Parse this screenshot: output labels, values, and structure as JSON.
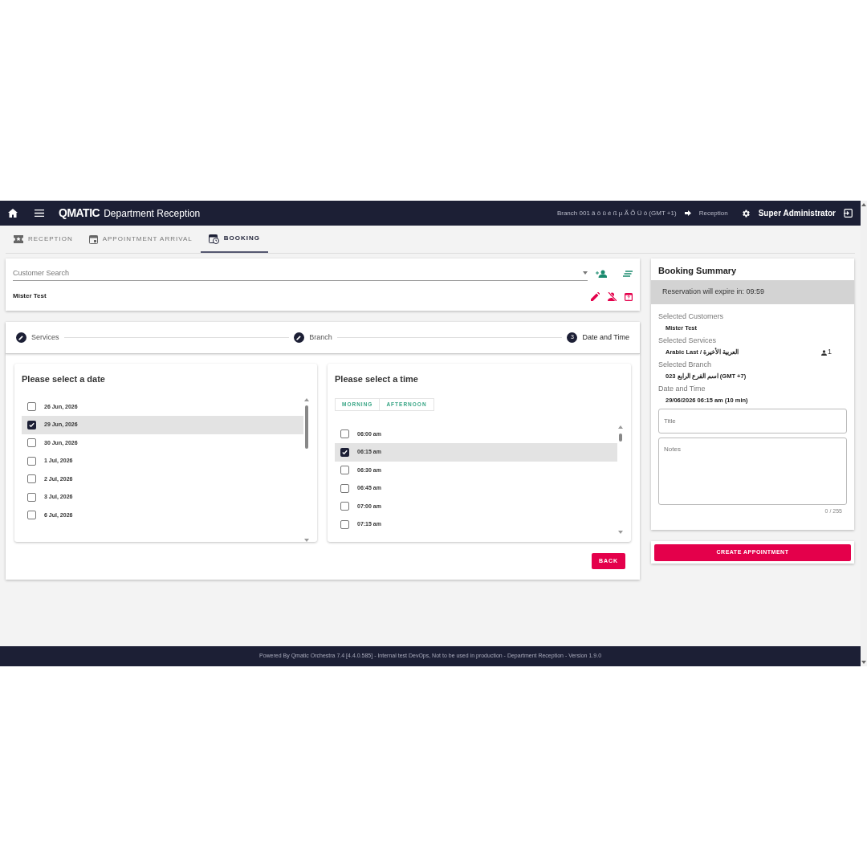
{
  "header": {
    "app_name": "Department Reception",
    "logo": "QMATIC",
    "branch": "Branch 001 ä ö ü é ß µ Ã Õ Ü ô (GMT +1)",
    "workstation": "Reception",
    "user": "Super Administrator"
  },
  "tabs": [
    {
      "label": "RECEPTION",
      "selected": false
    },
    {
      "label": "APPOINTMENT ARRIVAL",
      "selected": false
    },
    {
      "label": "BOOKING",
      "selected": true
    }
  ],
  "customer": {
    "search_placeholder": "Customer Search",
    "selected_name": "Mister Test"
  },
  "stepper": [
    {
      "label": "Services",
      "kind": "done"
    },
    {
      "label": "Branch",
      "kind": "done"
    },
    {
      "label": "Date and Time",
      "kind": "active",
      "number": "3"
    }
  ],
  "date_panel": {
    "title": "Please select a date",
    "dates": [
      {
        "label": "26 Jun, 2026",
        "selected": false
      },
      {
        "label": "29 Jun, 2026",
        "selected": true
      },
      {
        "label": "30 Jun, 2026",
        "selected": false
      },
      {
        "label": "1 Jul, 2026",
        "selected": false
      },
      {
        "label": "2 Jul, 2026",
        "selected": false
      },
      {
        "label": "3 Jul, 2026",
        "selected": false
      },
      {
        "label": "6 Jul, 2026",
        "selected": false
      }
    ]
  },
  "time_panel": {
    "title": "Please select a time",
    "filters": [
      "MORNING",
      "AFTERNOON"
    ],
    "times": [
      {
        "label": "06:00 am",
        "selected": false
      },
      {
        "label": "06:15 am",
        "selected": true
      },
      {
        "label": "06:30 am",
        "selected": false
      },
      {
        "label": "06:45 am",
        "selected": false
      },
      {
        "label": "07:00 am",
        "selected": false
      },
      {
        "label": "07:15 am",
        "selected": false
      }
    ]
  },
  "back_button": "BACK",
  "summary": {
    "title": "Booking Summary",
    "expiry": "Reservation will expire in: 09:59",
    "sections": [
      {
        "label": "Selected Customers",
        "value": "Mister Test"
      },
      {
        "label": "Selected Services",
        "value": "Arabic Last / العربية الأخيرة",
        "count": "1"
      },
      {
        "label": "Selected Branch",
        "value": "023 اسم الفرع الرابع (GMT +7)"
      },
      {
        "label": "Date and Time",
        "value": "29/06/2026 06:15 am (10 min)"
      }
    ],
    "title_placeholder": "Title",
    "notes_placeholder": "Notes",
    "char_count": "0 / 255"
  },
  "create_button": "CREATE APPOINTMENT",
  "footer": "Powered By Qmatic Orchestra 7.4 [4.4.0.585] - Internal test DevOps, Not to be used in production - Department Reception - Version 1.9.0"
}
